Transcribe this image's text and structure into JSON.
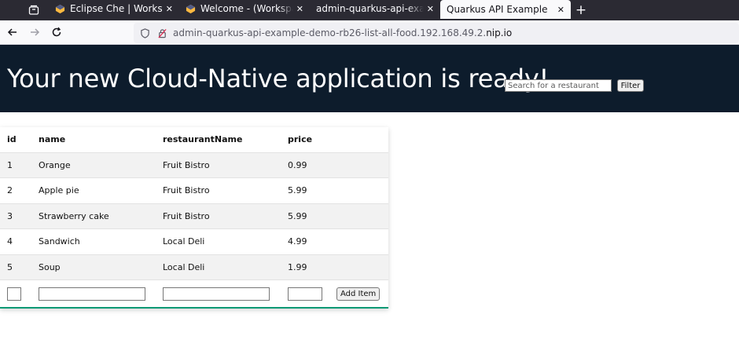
{
  "browser": {
    "tabs": [
      {
        "title": "Eclipse Che | Workspaces",
        "favicon": "eclipse-che-icon",
        "active": false
      },
      {
        "title": "Welcome - (Workspace) -",
        "favicon": "eclipse-che-icon",
        "active": false
      },
      {
        "title": "admin-quarkus-api-example-",
        "favicon": "",
        "active": false
      },
      {
        "title": "Quarkus API Example",
        "favicon": "",
        "active": true
      }
    ],
    "url_prefix": "admin-quarkus-api-example-demo-rb26-list-all-food.192.168.49.2.",
    "url_host": "nip.io"
  },
  "page": {
    "heading": "Your new Cloud-Native application is ready!",
    "search_placeholder": "Search for a restaurant",
    "filter_label": "Filter",
    "columns": [
      "id",
      "name",
      "restaurantName",
      "price"
    ],
    "rows": [
      {
        "id": "1",
        "name": "Orange",
        "restaurantName": "Fruit Bistro",
        "price": "0.99"
      },
      {
        "id": "2",
        "name": "Apple pie",
        "restaurantName": "Fruit Bistro",
        "price": "5.99"
      },
      {
        "id": "3",
        "name": "Strawberry cake",
        "restaurantName": "Fruit Bistro",
        "price": "5.99"
      },
      {
        "id": "4",
        "name": "Sandwich",
        "restaurantName": "Local Deli",
        "price": "4.99"
      },
      {
        "id": "5",
        "name": "Soup",
        "restaurantName": "Local Deli",
        "price": "1.99"
      }
    ],
    "add_item_label": "Add Item"
  },
  "colors": {
    "hero_bg": "#0d1c2c",
    "table_accent": "#009a75",
    "tabbar_bg": "#2b2a33"
  }
}
